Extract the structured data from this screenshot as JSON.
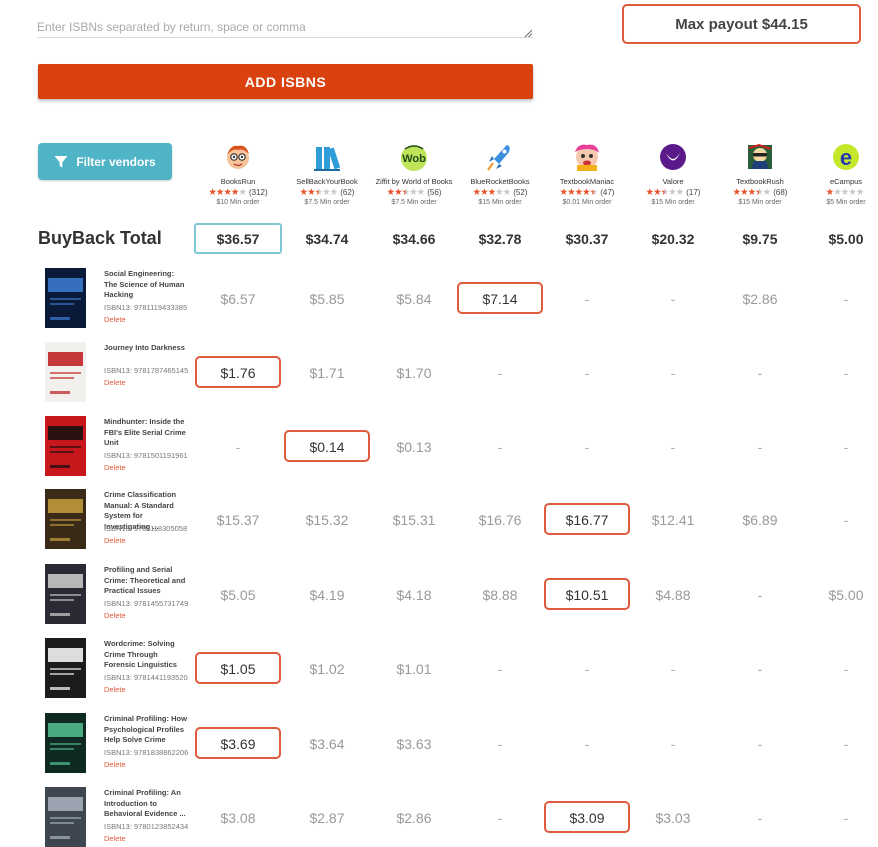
{
  "isbn_input": {
    "placeholder": "Enter ISBNs separated by return, space or comma",
    "value": ""
  },
  "max_payout": "Max payout $44.15",
  "add_button": "ADD ISBNS",
  "filter_button": "Filter vendors",
  "total_label": "BuyBack Total",
  "vendors": [
    {
      "name": "BooksRun",
      "stars": 4,
      "reviews": "(312)",
      "min_order": "$10 Min order",
      "total": "$36.57",
      "best": true,
      "icon": "booksrun-logo"
    },
    {
      "name": "SellBackYourBook",
      "stars": 2.5,
      "reviews": "(62)",
      "min_order": "$7.5 Min order",
      "total": "$34.74",
      "best": false,
      "icon": "sellbackyourbook-logo"
    },
    {
      "name": "Ziffit by World of Books",
      "stars": 2.5,
      "reviews": "(56)",
      "min_order": "$7.5 Min order",
      "total": "$34.66",
      "best": false,
      "icon": "wob-logo"
    },
    {
      "name": "BlueRocketBooks",
      "stars": 3,
      "reviews": "(52)",
      "min_order": "$15 Min order",
      "total": "$32.78",
      "best": false,
      "icon": "bluerocket-logo"
    },
    {
      "name": "TextbookManiac",
      "stars": 4.5,
      "reviews": "(47)",
      "min_order": "$0.01 Min order",
      "total": "$30.37",
      "best": false,
      "icon": "textbookmaniac-logo"
    },
    {
      "name": "Valore",
      "stars": 2.5,
      "reviews": "(17)",
      "min_order": "$15 Min order",
      "total": "$20.32",
      "best": false,
      "icon": "valore-logo"
    },
    {
      "name": "TextbookRush",
      "stars": 3.5,
      "reviews": "(68)",
      "min_order": "$15 Min order",
      "total": "$9.75",
      "best": false,
      "icon": "textbookrush-logo"
    },
    {
      "name": "eCampus",
      "stars": 1,
      "reviews": "",
      "min_order": "$5 Min order",
      "total": "$5.00",
      "best": false,
      "icon": "ecampus-logo"
    }
  ],
  "books": [
    {
      "title": "Social Engineering: The Science of Human Hacking",
      "isbn": "ISBN13: 9781119433385",
      "delete": "Delete",
      "cover": {
        "bg": "#0c1a3a",
        "accent": "#3d7fd6",
        "text": "SOCIAL ENGINEERING"
      },
      "prices": [
        "$6.57",
        "$5.85",
        "$5.84",
        "$7.14",
        "-",
        "-",
        "$2.86",
        "-"
      ],
      "best": 3
    },
    {
      "title": "Journey Into Darkness",
      "isbn": "ISBN13: 9781787465145",
      "delete": "Delete",
      "cover": {
        "bg": "#f2f0ec",
        "accent": "#c0181c",
        "text": "JOURNEY INTO DARKNESS"
      },
      "prices": [
        "$1.76",
        "$1.71",
        "$1.70",
        "-",
        "-",
        "-",
        "-",
        "-"
      ],
      "best": 0
    },
    {
      "title": "Mindhunter: Inside the FBI's Elite Serial Crime Unit",
      "isbn": "ISBN13: 9781501191961",
      "delete": "Delete",
      "cover": {
        "bg": "#c8161d",
        "accent": "#111111",
        "text": "MINDHUNTER"
      },
      "prices": [
        "-",
        "$0.14",
        "$0.13",
        "-",
        "-",
        "-",
        "-",
        "-"
      ],
      "best": 1
    },
    {
      "title": "Crime Classification Manual: A Standard System for Investigating ...",
      "isbn": "ISBN13: 9781118305058",
      "delete": "Delete",
      "cover": {
        "bg": "#3a2a18",
        "accent": "#c8a040",
        "text": "CRIME CLASSIFICATION MANUAL"
      },
      "prices": [
        "$15.37",
        "$15.32",
        "$15.31",
        "$16.76",
        "$16.77",
        "$12.41",
        "$6.89",
        "-"
      ],
      "best": 4
    },
    {
      "title": "Profiling and Serial Crime: Theoretical and Practical Issues",
      "isbn": "ISBN13: 9781455731749",
      "delete": "Delete",
      "cover": {
        "bg": "#2a2a34",
        "accent": "#d0d0d0",
        "text": "PROFILING AND SERIAL CRIME"
      },
      "prices": [
        "$5.05",
        "$4.19",
        "$4.18",
        "$8.88",
        "$10.51",
        "$4.88",
        "-",
        "$5.00"
      ],
      "best": 4
    },
    {
      "title": "Wordcrime: Solving Crime Through Forensic Linguistics",
      "isbn": "ISBN13: 9781441193520",
      "delete": "Delete",
      "cover": {
        "bg": "#1c1c1c",
        "accent": "#ffffff",
        "text": "WORD CRIME"
      },
      "prices": [
        "$1.05",
        "$1.02",
        "$1.01",
        "-",
        "-",
        "-",
        "-",
        "-"
      ],
      "best": 0
    },
    {
      "title": "Criminal Profiling: How Psychological Profiles Help Solve Crime",
      "isbn": "ISBN13: 9781838862206",
      "delete": "Delete",
      "cover": {
        "bg": "#0f2a22",
        "accent": "#56c090",
        "text": "CRIMINAL PROFILING"
      },
      "prices": [
        "$3.69",
        "$3.64",
        "$3.63",
        "-",
        "-",
        "-",
        "-",
        "-"
      ],
      "best": 0
    },
    {
      "title": "Criminal Profiling: An Introduction to Behavioral Evidence ...",
      "isbn": "ISBN13: 9780123852434",
      "delete": "Delete",
      "cover": {
        "bg": "#3e4650",
        "accent": "#aab4c0",
        "text": "Criminal Profiling"
      },
      "prices": [
        "$3.08",
        "$2.87",
        "$2.86",
        "-",
        "$3.09",
        "$3.03",
        "-",
        "-"
      ],
      "best": 4
    }
  ]
}
